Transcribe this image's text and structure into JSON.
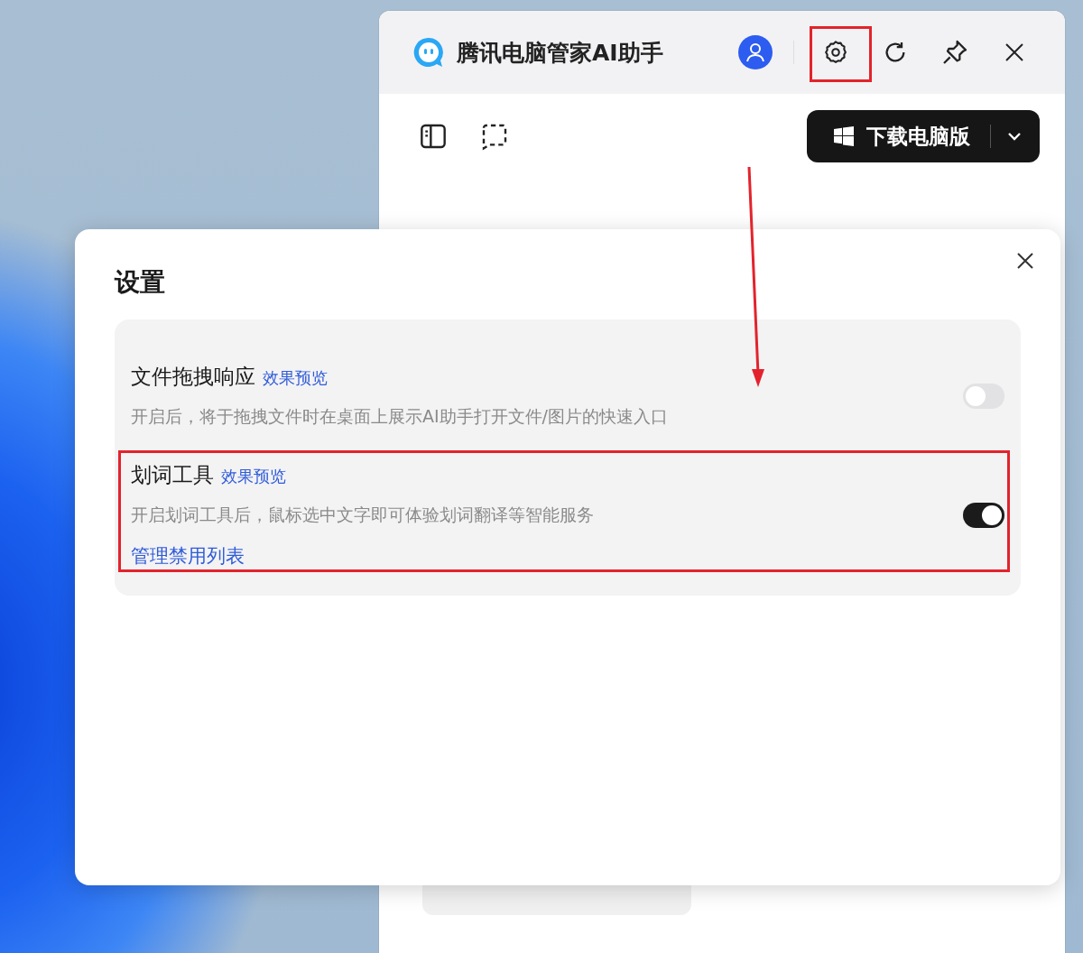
{
  "app": {
    "title": "腾讯电脑管家AI助手",
    "download_button": {
      "label": "下载电脑版"
    }
  },
  "settings_dialog": {
    "title": "设置",
    "items": [
      {
        "title": "文件拖拽响应",
        "preview_link": "效果预览",
        "description": "开启后，将于拖拽文件时在桌面上展示AI助手打开文件/图片的快速入口",
        "on": false
      },
      {
        "title": "划词工具",
        "preview_link": "效果预览",
        "description": "开启划词工具后，鼠标选中文字即可体验划词翻译等智能服务",
        "link": "管理禁用列表",
        "on": true
      }
    ]
  }
}
